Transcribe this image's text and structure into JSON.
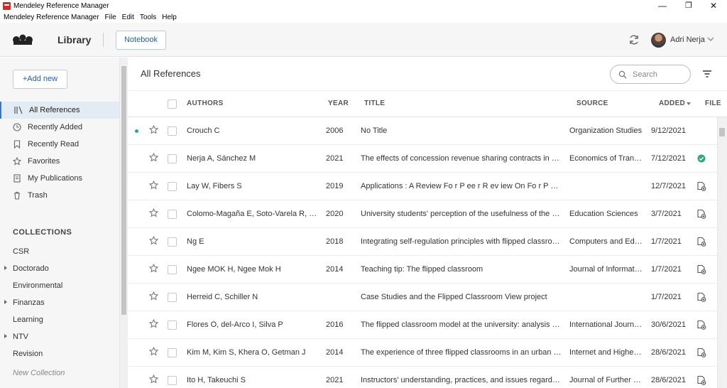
{
  "window": {
    "title": "Mendeley Reference Manager",
    "controls": {
      "minimize": "—",
      "maximize": "❐",
      "close": "✕"
    }
  },
  "menu": [
    "Mendeley Reference Manager",
    "File",
    "Edit",
    "Tools",
    "Help"
  ],
  "header": {
    "library_label": "Library",
    "notebook_label": "Notebook",
    "user_name": "Adri Nerja"
  },
  "sidebar": {
    "add_new_label": "+Add new",
    "nav": [
      {
        "label": "All References",
        "icon": "library-icon",
        "active": true
      },
      {
        "label": "Recently Added",
        "icon": "clock-icon",
        "active": false
      },
      {
        "label": "Recently Read",
        "icon": "bookmark-icon",
        "active": false
      },
      {
        "label": "Favorites",
        "icon": "star-icon",
        "active": false
      },
      {
        "label": "My Publications",
        "icon": "document-icon",
        "active": false
      },
      {
        "label": "Trash",
        "icon": "trash-icon",
        "active": false
      }
    ],
    "collections_header": "COLLECTIONS",
    "collections": [
      {
        "label": "CSR",
        "expandable": false
      },
      {
        "label": "Doctorado",
        "expandable": true
      },
      {
        "label": "Environmental",
        "expandable": false
      },
      {
        "label": "Finanzas",
        "expandable": true
      },
      {
        "label": "Learning",
        "expandable": false
      },
      {
        "label": "NTV",
        "expandable": true
      },
      {
        "label": "Revision",
        "expandable": false
      }
    ],
    "new_collection_label": "New Collection"
  },
  "main": {
    "title": "All References",
    "search_placeholder": "Search",
    "columns": {
      "authors": "AUTHORS",
      "year": "YEAR",
      "title": "TITLE",
      "source": "SOURCE",
      "added": "ADDED",
      "file": "FILE"
    },
    "rows": [
      {
        "unread": true,
        "authors": "Crouch C",
        "year": "2006",
        "title": "No Title",
        "source": "Organization Studies",
        "added": "9/12/2021",
        "file": "none"
      },
      {
        "unread": false,
        "authors": "Nerja A, Sánchez M",
        "year": "2021",
        "title": "The effects of concession revenue sharing contracts in airpor...",
        "source": "Economics of Transport...",
        "added": "7/12/2021",
        "file": "downloaded"
      },
      {
        "unread": false,
        "authors": "Lay W, Fibers S",
        "year": "2019",
        "title": "Applications : A Review Fo r P ee r R ev iew On Fo r P ee r Revi...",
        "source": "",
        "added": "12/7/2021",
        "file": "available"
      },
      {
        "unread": false,
        "authors": "Colomo-Magaña E, Soto-Varela R, Ruiz-...",
        "year": "2020",
        "title": "University students' perception of the usefulness of the flippe...",
        "source": "Education Sciences",
        "added": "3/7/2021",
        "file": "available"
      },
      {
        "unread": false,
        "authors": "Ng E",
        "year": "2018",
        "title": "Integrating self-regulation principles with flipped classroom p...",
        "source": "Computers and Educati...",
        "added": "1/7/2021",
        "file": "available"
      },
      {
        "unread": false,
        "authors": "Ngee MOK H, Ngee Mok H",
        "year": "2014",
        "title": "Teaching tip: The flipped classroom",
        "source": "Journal of Information S...",
        "added": "1/7/2021",
        "file": "available"
      },
      {
        "unread": false,
        "authors": "Herreid C, Schiller N",
        "year": "",
        "title": "Case Studies and the Flipped Classroom View project",
        "source": "",
        "added": "1/7/2021",
        "file": "available"
      },
      {
        "unread": false,
        "authors": "Flores Ò, del-Arco I, Silva P",
        "year": "2016",
        "title": "The flipped classroom model at the university: analysis based ...",
        "source": "International Journal of ...",
        "added": "30/6/2021",
        "file": "available"
      },
      {
        "unread": false,
        "authors": "Kim M, Kim S, Khera O, Getman J",
        "year": "2014",
        "title": "The experience of three flipped classrooms in an urban univer...",
        "source": "Internet and Higher Edu...",
        "added": "28/6/2021",
        "file": "available"
      },
      {
        "unread": false,
        "authors": "Ito H, Takeuchi S",
        "year": "2021",
        "title": "Instructors' understanding, practices, and issues regarding th...",
        "source": "Journal of Further and ...",
        "added": "28/6/2021",
        "file": "available"
      }
    ]
  },
  "colors": {
    "accent": "#1f5fa6",
    "unread_dot": "#2fa884",
    "file_ok": "#2fa884"
  }
}
